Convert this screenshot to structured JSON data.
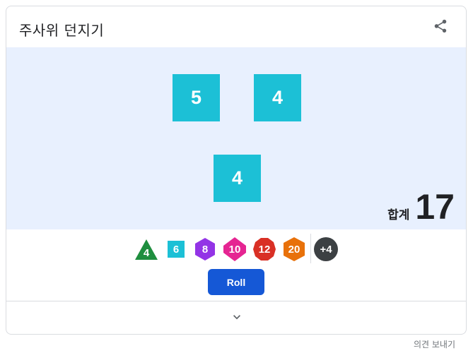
{
  "header": {
    "title": "주사위 던지기",
    "share_icon": "share-icon"
  },
  "dice": {
    "color": "#1cc0d6",
    "background": "#e8f0fe",
    "results": [
      "5",
      "4",
      "4"
    ]
  },
  "total": {
    "label": "합계",
    "value": "17"
  },
  "die_types": [
    {
      "label": "4",
      "shape": "triangle",
      "color": "#1e8e3e"
    },
    {
      "label": "6",
      "shape": "square",
      "color": "#1cc0d6"
    },
    {
      "label": "8",
      "shape": "hexagon",
      "color": "#9334e6"
    },
    {
      "label": "10",
      "shape": "diamond",
      "color": "#e52592"
    },
    {
      "label": "12",
      "shape": "decagon",
      "color": "#d93025"
    },
    {
      "label": "20",
      "shape": "hexagon",
      "color": "#e8710a"
    },
    {
      "label": "+4",
      "shape": "circle",
      "color": "#3c4043"
    }
  ],
  "roll_button": {
    "label": "Roll",
    "color": "#1558d6"
  },
  "expand_icon": "chevron-down-icon",
  "feedback_link": "의견 보내기"
}
